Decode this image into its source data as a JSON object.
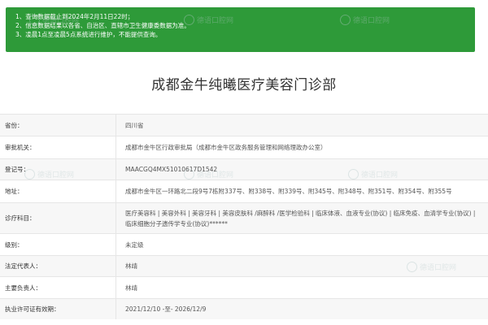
{
  "notice": {
    "lines": [
      "1、查询数据截止到2024年2月11日22时；",
      "2、信息数据结果以各省、自治区、直辖市卫生健康委数据为准。",
      "3、凌晨1点至凌晨5点系统进行维护，不能提供查询。"
    ]
  },
  "page": {
    "title": "成都金牛纯曦医疗美容门诊部"
  },
  "info": {
    "rows": [
      {
        "label": "省份：",
        "value": "四川省"
      },
      {
        "label": "审批机关：",
        "value": "成都市金牛区行政审批局（成都市金牛区政务服务管理和网络理政办公室）"
      },
      {
        "label": "登记号：",
        "value": "MAACGQ4MX51010617D1542"
      },
      {
        "label": "地址：",
        "value": "成都市金牛区一环路北二段9号7栋附337号、附338号、附339号、附345号、附348号、附351号、附354号、附355号"
      },
      {
        "label": "诊疗科目：",
        "value": "医疗美容科 | 美容外科 | 美容牙科 | 美容皮肤科 /麻醉科 /医学检验科 | 临床体液、血液专业(协议) | 临床免疫、血清学专业(协议) | 临床细胞分子遗传学专业(协议)******"
      },
      {
        "label": "级别：",
        "value": "未定级"
      },
      {
        "label": "法定代表人：",
        "value": "林靖"
      },
      {
        "label": "主要负责人：",
        "value": "林靖"
      },
      {
        "label": "执业许可证有效期：",
        "value": "2021/12/10 -至- 2026/12/9"
      }
    ]
  },
  "watermark": {
    "text": "德语口腔网"
  }
}
